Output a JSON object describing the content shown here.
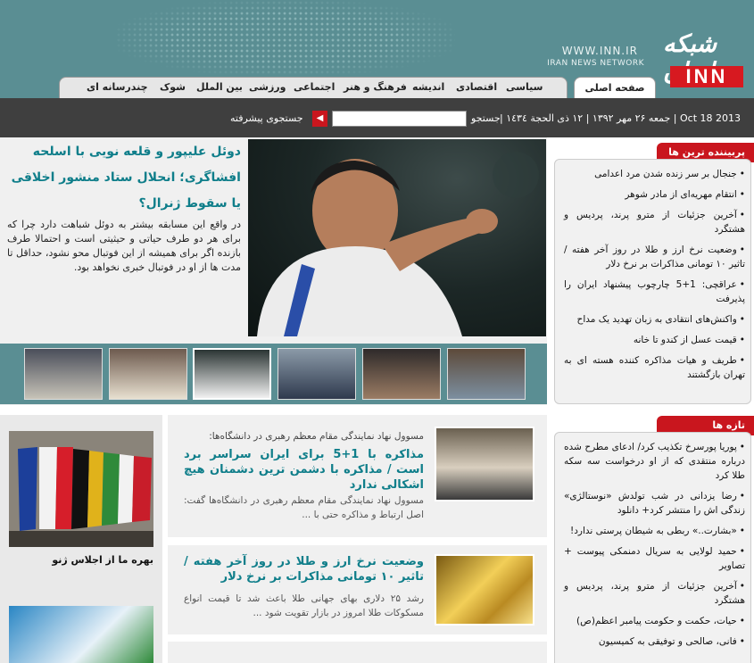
{
  "site": {
    "url": "WWW.INN.IR",
    "network": "IRAN NEWS NETWORK",
    "logo_fa": "شبکه ایران",
    "logo_en": "INN"
  },
  "nav": {
    "home": "صفحه اصلی",
    "items": [
      "سیاسی",
      "اقتصادی",
      "اندیشه",
      "فرهنگ و هنر",
      "اجتماعی",
      "ورزشی",
      "بین الملل",
      "شوک",
      "چندرسانه ای"
    ]
  },
  "topbar": {
    "date": "Oct 18 2013 | جمعه ۲۶ مهر ۱۳۹۲ | ۱۲ ذی الحجة ۱٤۳٤ |",
    "search_label": "جستجو",
    "search_value": "",
    "advanced": "جستجوی پیشرفته"
  },
  "featured": {
    "title": "دوئل علیپور و قلعه نویی با اسلحه افشاگری؛ انحلال ستاد منشور اخلاقی یا سقوط ژنرال؟",
    "summary": "در واقع این مسابقه بیشتر به دوئل شباهت دارد چرا که برای هر دو طرف حیاتی و حیثیتی است و احتمالا طرف بازنده اگر برای همیشه از این فوتبال محو نشود، حداقل تا مدت ها از او در فوتبال خبری نخواهد بود."
  },
  "sidebar": {
    "popular_title": "پربیننده ترین ها",
    "popular": [
      "جنجال بر سر زنده شدن مرد اعدامی",
      "انتقام مهریه‌ای از مادر شوهر",
      "آخرین جزئیات از مترو پرند، پردیس و هشتگرد",
      "وضعیت نرخ ارز و طلا در روز آخر هفته / تاثیر ۱۰ تومانی مذاکرات بر نرخ دلار",
      "عراقچی: 1+5 چارچوب پیشنهاد ایران را پذیرفت",
      "واکنش‌های انتقادی به زبان تهدید یک مداح",
      "قیمت عسل از کندو تا خانه",
      "طریف و هیات مذاکره کننده هسته ای به تهران بازگشتند"
    ],
    "latest_title": "تازه ها",
    "latest": [
      "پوریا پورسرخ تکذیب کرد/ ادعای مطرح شده درباره منتقدی که از او درخواست سه سکه طلا کرد",
      "رضا یزدانی در شب تولدش «نوستالژی» زندگی اش را منتشر کرد+ دانلود",
      "«بشارت..» ربطی به شیطان پرستی ندارد!",
      "حمید لولایی به سریال دمنمکی پیوست + تصاویر",
      "آخرین جزئیات از مترو پرند، پردیس و هشتگرد",
      "حیات، حکمت و حکومت پیامبر اعظم(ص)",
      "فانی، صالحی و توفیقی به کمیسیون"
    ]
  },
  "side_panel": {
    "caption": "بهره ما از اجلاس ژنو"
  },
  "stories": [
    {
      "kicker": "مسوول نهاد نمایندگی مقام معظم رهبری در دانشگاه‌ها:",
      "title": "مذاکره با 1+5 برای ایران سراسر برد است / مذاکره با دشمن ترین دشمنان هیچ اشکالی ندارد",
      "text": "مسوول نهاد نمایندگی مقام معظم رهبری در دانشگاه‌ها گفت: اصل ارتباط و مذاکره حتی با ..."
    },
    {
      "kicker": "",
      "title": "وضعیت نرخ ارز و طلا در روز آخر هفته / تاثیر ۱۰ تومانی مذاکرات بر نرخ دلار",
      "text": "رشد ۲۵ دلاری بهای جهانی طلا باعث شد تا قیمت انواع مسکوکات طلا امروز در بازار تقویت شود ..."
    }
  ]
}
